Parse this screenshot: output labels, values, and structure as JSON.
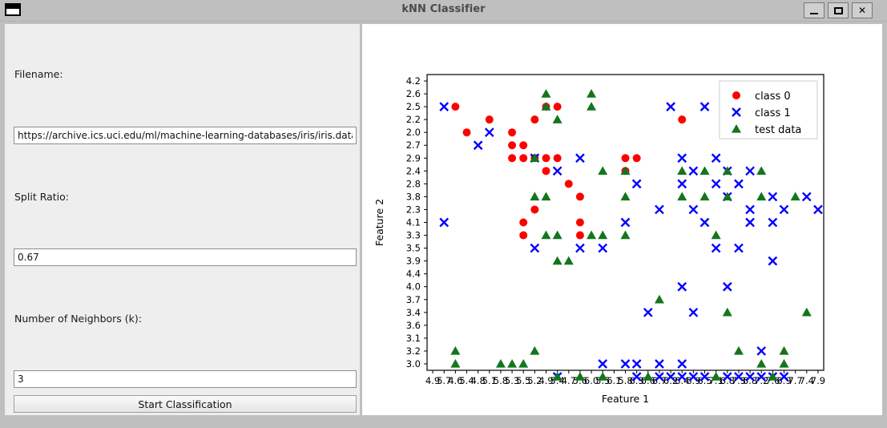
{
  "window": {
    "title": "kNN Classifier",
    "icon": "window-icon",
    "controls": {
      "minimize": "_",
      "maximize": "□",
      "close": "✕"
    }
  },
  "form": {
    "filename_label": "Filename:",
    "filename_value": "https://archive.ics.uci.edu/ml/machine-learning-databases/iris/iris.data",
    "filename_placeholder": "",
    "split_label": "Split Ratio:",
    "split_value": "0.67",
    "split_placeholder": "",
    "k_label": "Number of Neighbors (k):",
    "k_value": "3",
    "k_placeholder": "",
    "start_button": "Start Classification"
  },
  "chart_data": {
    "type": "scatter",
    "title": "",
    "xlabel": "Feature 1",
    "ylabel": "Feature 2",
    "grid": false,
    "legend_position": "upper right",
    "x_categories": [
      "4.9",
      "5.7",
      "4.6",
      "5.4",
      "4.8",
      "5.1",
      "5.8",
      "5.3",
      "5.5",
      "5.2",
      "4.9",
      "5.4",
      "4.7",
      "5.6",
      "6.0",
      "5.5",
      "6.1",
      "5.8",
      "6.3",
      "6.6",
      "6.7",
      "6.2",
      "6.4",
      "6.9",
      "6.5",
      "7.1",
      "6.8",
      "7.3",
      "6.8",
      "7.2",
      "7.6",
      "6.9",
      "7.7",
      "7.4",
      "7.9"
    ],
    "y_categories": [
      "4.2",
      "2.6",
      "2.5",
      "2.2",
      "2.0",
      "2.7",
      "2.9",
      "2.4",
      "2.8",
      "3.8",
      "2.3",
      "4.1",
      "3.3",
      "3.5",
      "3.9",
      "4.4",
      "4.0",
      "3.7",
      "3.4",
      "3.6",
      "3.1",
      "3.2",
      "3.0"
    ],
    "series": [
      {
        "name": "class 0",
        "marker": "circle",
        "color": "#ff0000",
        "points": [
          [
            8,
            12
          ],
          [
            8,
            11
          ],
          [
            9,
            10
          ],
          [
            13,
            9
          ],
          [
            12,
            8
          ],
          [
            10,
            7
          ],
          [
            7,
            6
          ],
          [
            8,
            6
          ],
          [
            9,
            6
          ],
          [
            10,
            6
          ],
          [
            11,
            6
          ],
          [
            7,
            5
          ],
          [
            8,
            5
          ],
          [
            3,
            4
          ],
          [
            7,
            4
          ],
          [
            5,
            3
          ],
          [
            9,
            3
          ],
          [
            2,
            2
          ],
          [
            10,
            2
          ],
          [
            11,
            2
          ],
          [
            22,
            3
          ],
          [
            13,
            12
          ],
          [
            13,
            11
          ],
          [
            17,
            7
          ],
          [
            17,
            6
          ],
          [
            18,
            6
          ]
        ]
      },
      {
        "name": "class 1",
        "marker": "x",
        "color": "#0000ff",
        "points": [
          [
            1,
            2
          ],
          [
            5,
            4
          ],
          [
            21,
            2
          ],
          [
            24,
            2
          ],
          [
            32,
            2
          ],
          [
            4,
            5
          ],
          [
            15,
            13
          ],
          [
            9,
            6
          ],
          [
            13,
            6
          ],
          [
            11,
            7
          ],
          [
            22,
            6
          ],
          [
            25,
            6
          ],
          [
            23,
            7
          ],
          [
            26,
            7
          ],
          [
            28,
            7
          ],
          [
            18,
            8
          ],
          [
            22,
            8
          ],
          [
            25,
            8
          ],
          [
            26,
            9
          ],
          [
            27,
            8
          ],
          [
            30,
            9
          ],
          [
            33,
            9
          ],
          [
            20,
            10
          ],
          [
            23,
            10
          ],
          [
            28,
            10
          ],
          [
            31,
            10
          ],
          [
            34,
            10
          ],
          [
            1,
            11
          ],
          [
            17,
            11
          ],
          [
            24,
            11
          ],
          [
            28,
            11
          ],
          [
            30,
            11
          ],
          [
            9,
            13
          ],
          [
            13,
            13
          ],
          [
            25,
            13
          ],
          [
            27,
            13
          ],
          [
            30,
            14
          ],
          [
            22,
            16
          ],
          [
            26,
            16
          ],
          [
            19,
            18
          ],
          [
            23,
            18
          ],
          [
            29,
            21
          ],
          [
            15,
            22
          ],
          [
            17,
            22
          ],
          [
            18,
            22
          ],
          [
            20,
            22
          ],
          [
            22,
            22
          ],
          [
            11,
            23
          ],
          [
            18,
            23
          ],
          [
            20,
            23
          ],
          [
            21,
            23
          ],
          [
            22,
            23
          ],
          [
            23,
            23
          ],
          [
            24,
            23
          ],
          [
            26,
            23
          ],
          [
            27,
            23
          ],
          [
            28,
            23
          ],
          [
            29,
            23
          ],
          [
            30,
            23
          ],
          [
            31,
            23
          ]
        ]
      },
      {
        "name": "test data",
        "marker": "triangle",
        "color": "#13761d",
        "points": [
          [
            10,
            1
          ],
          [
            14,
            1
          ],
          [
            10,
            2
          ],
          [
            14,
            2
          ],
          [
            11,
            3
          ],
          [
            9,
            6
          ],
          [
            15,
            7
          ],
          [
            17,
            7
          ],
          [
            22,
            7
          ],
          [
            24,
            7
          ],
          [
            26,
            7
          ],
          [
            29,
            7
          ],
          [
            9,
            9
          ],
          [
            10,
            9
          ],
          [
            17,
            9
          ],
          [
            22,
            9
          ],
          [
            24,
            9
          ],
          [
            26,
            9
          ],
          [
            29,
            9
          ],
          [
            32,
            9
          ],
          [
            10,
            12
          ],
          [
            11,
            12
          ],
          [
            14,
            12
          ],
          [
            15,
            12
          ],
          [
            17,
            12
          ],
          [
            25,
            12
          ],
          [
            11,
            14
          ],
          [
            12,
            14
          ],
          [
            20,
            17
          ],
          [
            26,
            18
          ],
          [
            33,
            18
          ],
          [
            2,
            21
          ],
          [
            9,
            21
          ],
          [
            27,
            21
          ],
          [
            31,
            21
          ],
          [
            2,
            22
          ],
          [
            6,
            22
          ],
          [
            7,
            22
          ],
          [
            8,
            22
          ],
          [
            29,
            22
          ],
          [
            31,
            22
          ],
          [
            11,
            23
          ],
          [
            13,
            23
          ],
          [
            15,
            23
          ],
          [
            19,
            23
          ],
          [
            25,
            23
          ],
          [
            30,
            23
          ]
        ]
      }
    ]
  }
}
